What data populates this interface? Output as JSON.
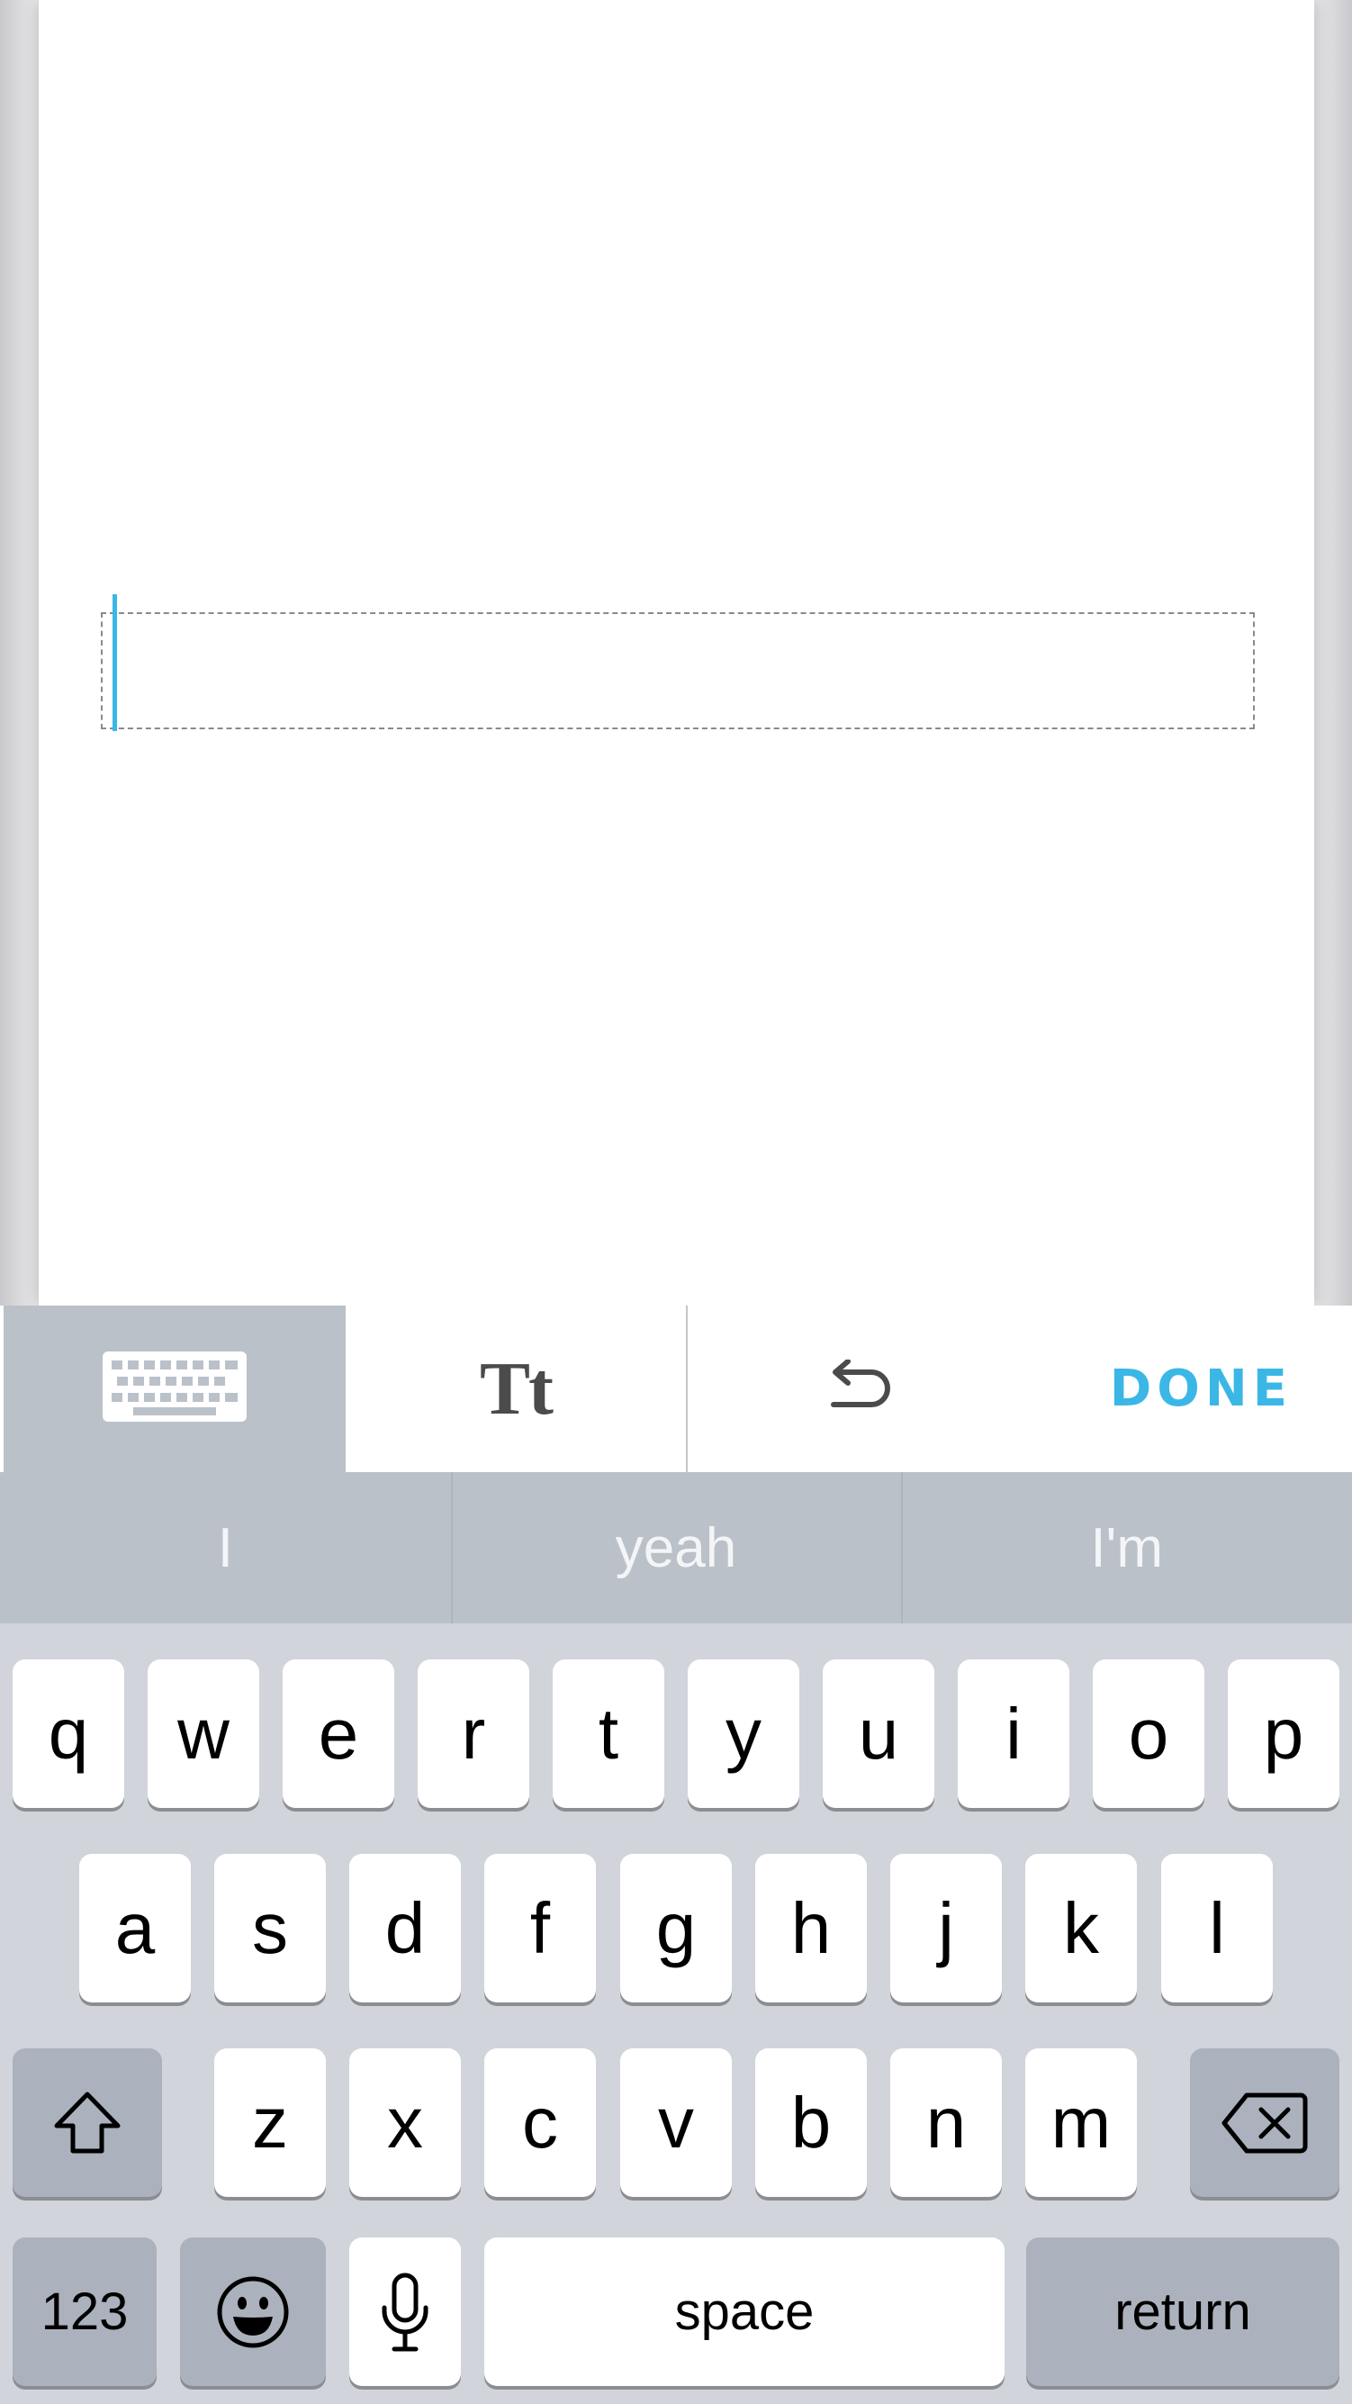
{
  "toolbar": {
    "keyboard_icon": "keyboard-icon",
    "text_style_label": "Tt",
    "undo_icon": "undo-icon",
    "done_label": "DONE"
  },
  "predictions": [
    "I",
    "yeah",
    "I'm"
  ],
  "keyboard": {
    "row1": [
      "q",
      "w",
      "e",
      "r",
      "t",
      "y",
      "u",
      "i",
      "o",
      "p"
    ],
    "row2": [
      "a",
      "s",
      "d",
      "f",
      "g",
      "h",
      "j",
      "k",
      "l"
    ],
    "row3": [
      "z",
      "x",
      "c",
      "v",
      "b",
      "n",
      "m"
    ],
    "shift_icon": "shift-icon",
    "delete_icon": "delete-icon",
    "numbers_label": "123",
    "emoji_icon": "emoji-icon",
    "mic_icon": "microphone-icon",
    "space_label": "space",
    "return_label": "return"
  },
  "colors": {
    "accent": "#3bb7e6",
    "keyboard_bg": "#d1d4da",
    "prediction_bg": "#bbc1c9",
    "function_key": "#abb2bd"
  }
}
